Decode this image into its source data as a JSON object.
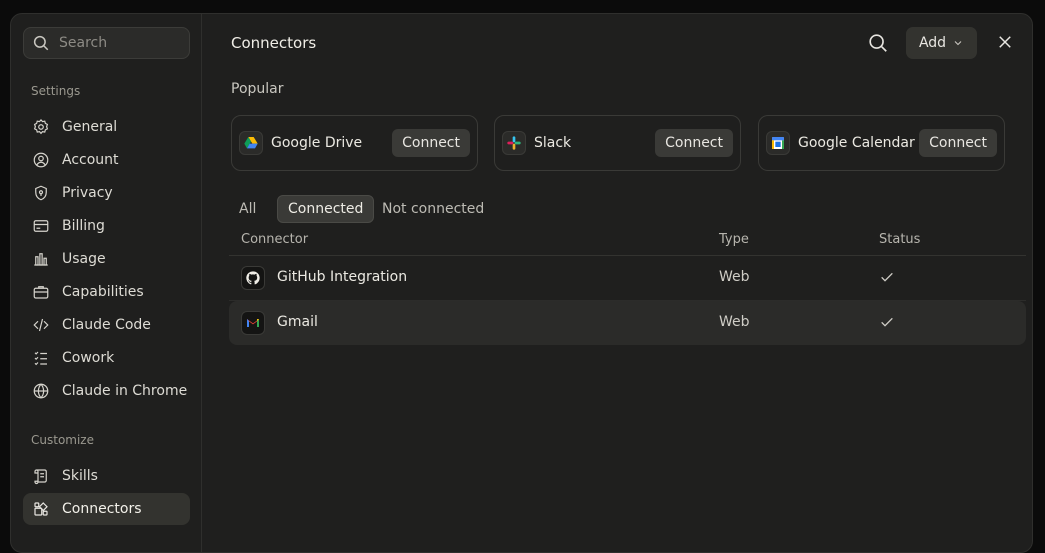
{
  "search": {
    "placeholder": "Search"
  },
  "sidebar": {
    "settings_label": "Settings",
    "settings_items": [
      {
        "label": "General",
        "icon": "gear-icon"
      },
      {
        "label": "Account",
        "icon": "user-circle-icon"
      },
      {
        "label": "Privacy",
        "icon": "shield-icon"
      },
      {
        "label": "Billing",
        "icon": "credit-card-icon"
      },
      {
        "label": "Usage",
        "icon": "bar-chart-icon"
      },
      {
        "label": "Capabilities",
        "icon": "briefcase-icon"
      },
      {
        "label": "Claude Code",
        "icon": "code-icon"
      },
      {
        "label": "Cowork",
        "icon": "checklist-icon"
      },
      {
        "label": "Claude in Chrome",
        "icon": "globe-icon"
      }
    ],
    "customize_label": "Customize",
    "customize_items": [
      {
        "label": "Skills",
        "icon": "scroll-icon"
      },
      {
        "label": "Connectors",
        "icon": "connectors-icon",
        "active": true
      }
    ]
  },
  "header": {
    "title": "Connectors",
    "add_label": "Add"
  },
  "popular": {
    "label": "Popular",
    "items": [
      {
        "name": "Google Drive",
        "icon": "google-drive-icon",
        "action": "Connect"
      },
      {
        "name": "Slack",
        "icon": "slack-icon",
        "action": "Connect"
      },
      {
        "name": "Google Calendar",
        "icon": "google-calendar-icon",
        "action": "Connect"
      }
    ]
  },
  "filters": [
    {
      "label": "All",
      "active": false
    },
    {
      "label": "Connected",
      "active": true
    },
    {
      "label": "Not connected",
      "active": false
    }
  ],
  "table": {
    "columns": [
      "Connector",
      "Type",
      "Status"
    ],
    "rows": [
      {
        "name": "GitHub Integration",
        "icon": "github-icon",
        "type": "Web",
        "status": "connected"
      },
      {
        "name": "Gmail",
        "icon": "gmail-icon",
        "type": "Web",
        "status": "connected"
      }
    ]
  },
  "colors": {
    "background": "#1f1f1e",
    "active_item": "#33332f",
    "button": "#3a3a37"
  }
}
